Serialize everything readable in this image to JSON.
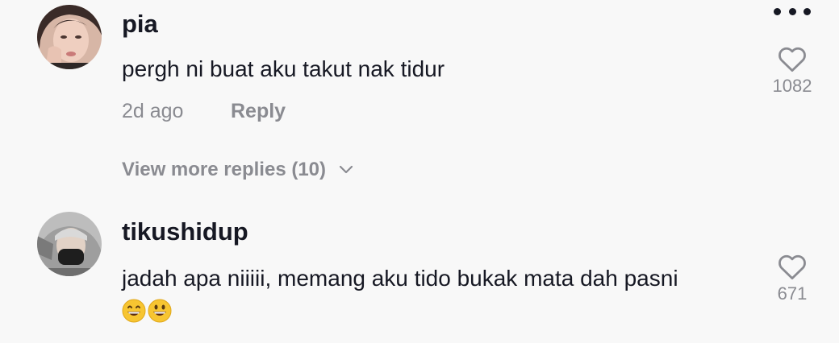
{
  "comments": [
    {
      "username": "pia",
      "text": "pergh ni buat aku takut nak tidur",
      "time": "2d ago",
      "reply_label": "Reply",
      "likes": "1082",
      "view_more_label": "View more replies (10)"
    },
    {
      "username": "tikushidup",
      "text": "jadah apa niiiii, memang aku tido bukak mata dah pasni",
      "emoji_line": "😄😃",
      "likes": "671"
    }
  ],
  "icons": {
    "more": "more-options-icon",
    "like": "heart-outline-icon",
    "expand": "chevron-down-icon"
  },
  "colors": {
    "background": "#f8f8f8",
    "primary_text": "#161823",
    "secondary_text": "#8a8b91"
  }
}
